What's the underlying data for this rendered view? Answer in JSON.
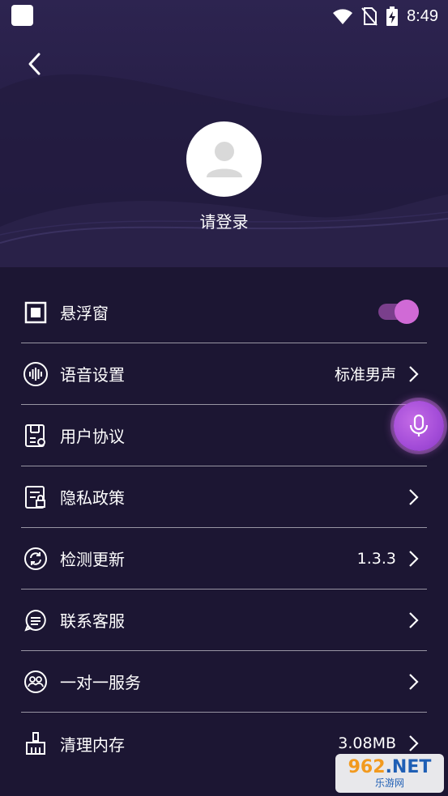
{
  "status_bar": {
    "time": "8:49"
  },
  "profile": {
    "login_label": "请登录"
  },
  "menu": [
    {
      "label": "悬浮窗",
      "icon": "floating-window-icon",
      "type": "toggle",
      "enabled": true
    },
    {
      "label": "语音设置",
      "icon": "voice-wave-icon",
      "value": "标准男声",
      "type": "nav"
    },
    {
      "label": "用户协议",
      "icon": "agreement-icon",
      "type": "nav"
    },
    {
      "label": "隐私政策",
      "icon": "privacy-policy-icon",
      "type": "nav"
    },
    {
      "label": "检测更新",
      "icon": "refresh-icon",
      "value": "1.3.3",
      "type": "nav"
    },
    {
      "label": "联系客服",
      "icon": "chat-bubble-icon",
      "type": "nav"
    },
    {
      "label": "一对一服务",
      "icon": "one-on-one-icon",
      "type": "nav"
    },
    {
      "label": "清理内存",
      "icon": "broom-icon",
      "value": "3.08MB",
      "type": "nav"
    }
  ],
  "watermark": {
    "top_digits": "962",
    "top_suffix": ".NET",
    "bottom": "乐游网"
  },
  "colors": {
    "background": "#1c1633",
    "header": "#2d2450",
    "toggle_knob": "#d06ad6",
    "toggle_track": "#7a3f8c",
    "fab": "#a34cd8"
  }
}
